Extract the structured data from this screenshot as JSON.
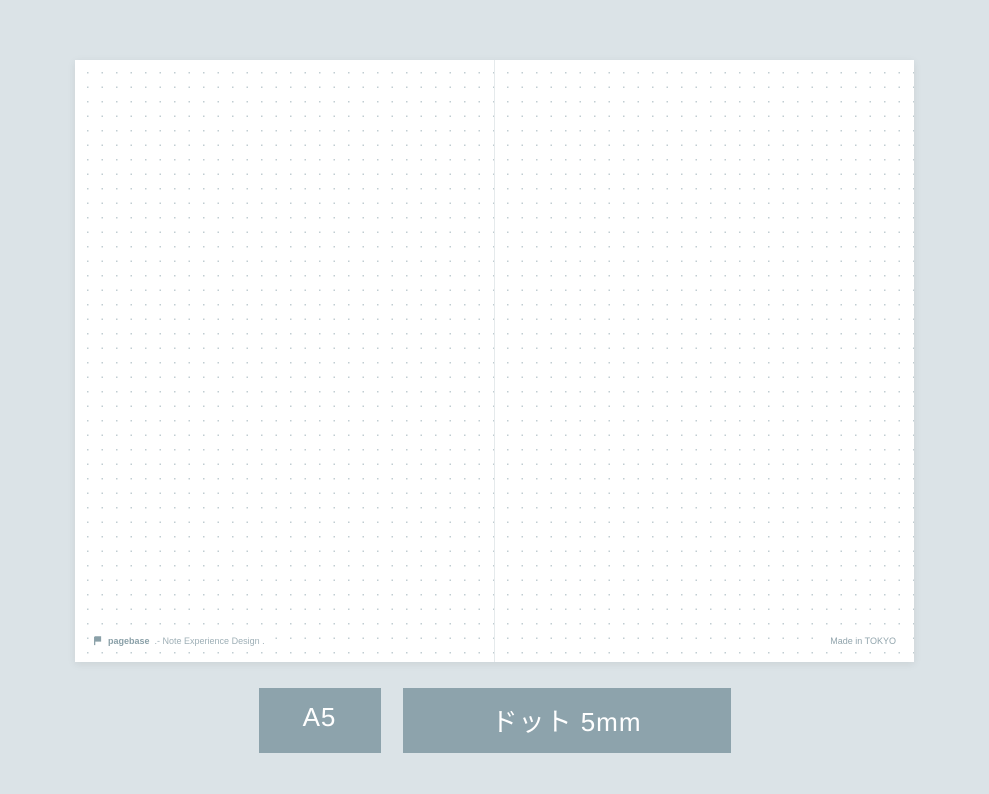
{
  "notebook": {
    "brand": "pagebase",
    "tagline": ".- Note Experience Design .",
    "made_in": "Made in TOKYO"
  },
  "labels": {
    "size": "A5",
    "detail": "ドット 5mm"
  }
}
